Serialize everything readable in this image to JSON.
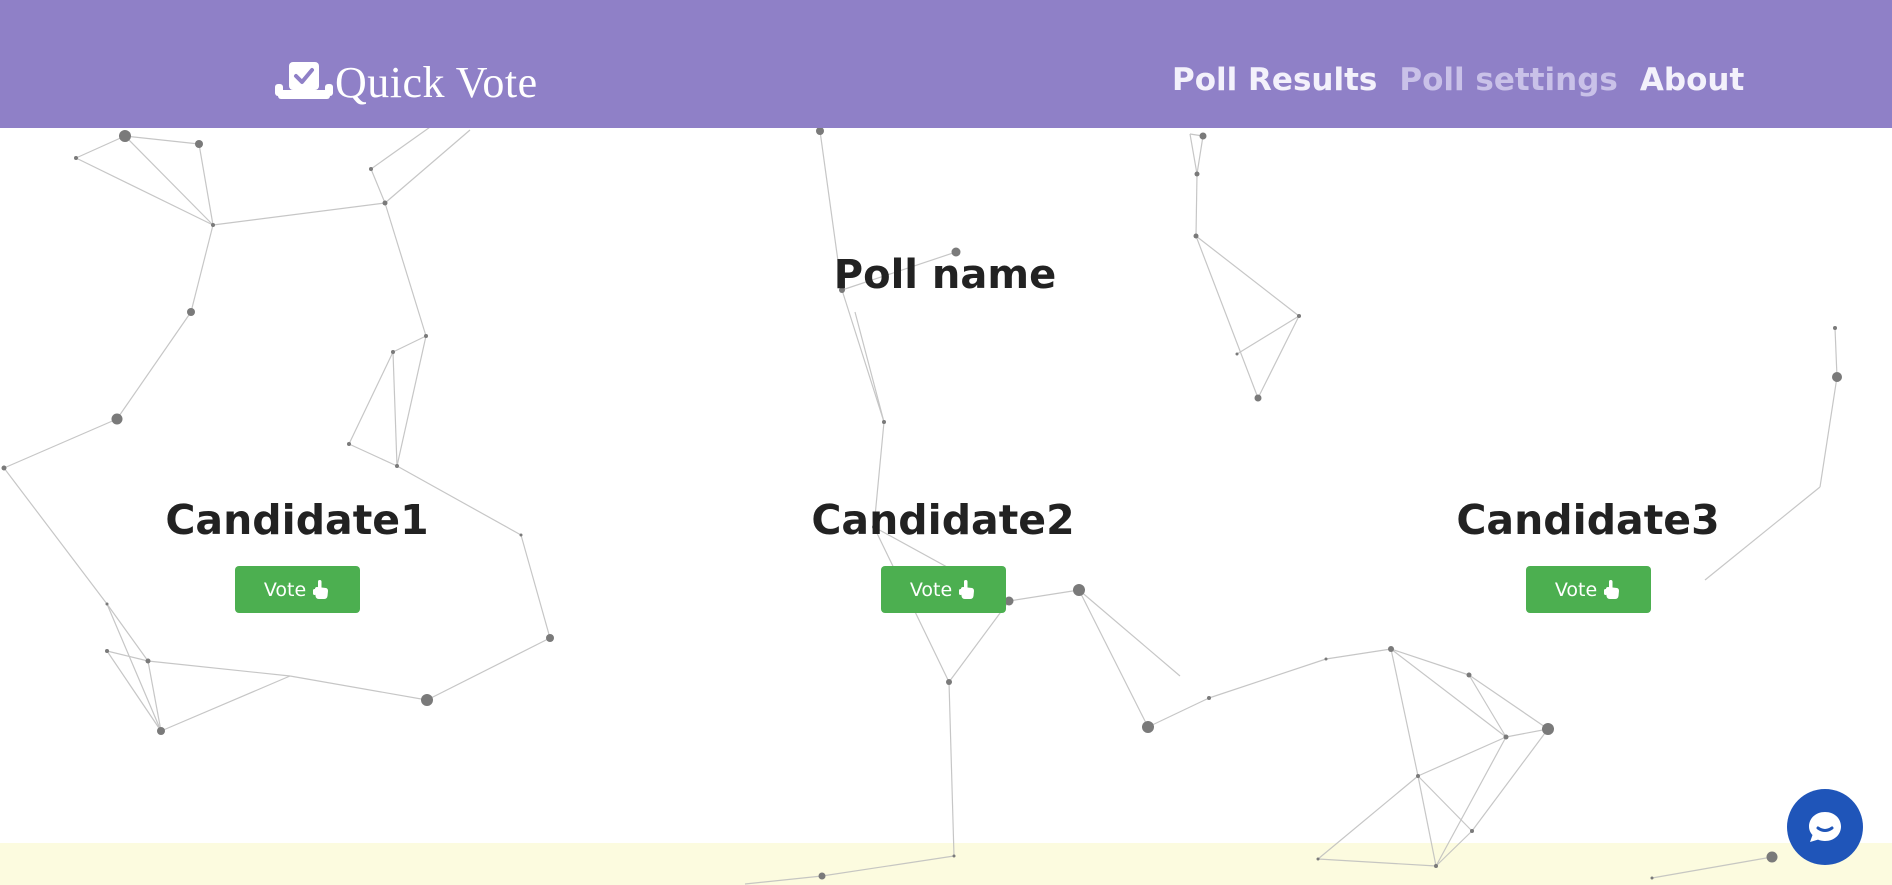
{
  "navbar": {
    "brand": "Quick Vote",
    "links": [
      {
        "label": "Poll Results",
        "state": "active"
      },
      {
        "label": "Poll settings",
        "state": "muted"
      },
      {
        "label": "About",
        "state": "active"
      }
    ],
    "background_color": "#8f80c7"
  },
  "poll": {
    "name": "Poll name",
    "candidates": [
      {
        "name": "Candidate1",
        "vote_label": "Vote"
      },
      {
        "name": "Candidate2",
        "vote_label": "Vote"
      },
      {
        "name": "Candidate3",
        "vote_label": "Vote"
      }
    ]
  },
  "colors": {
    "vote_button": "#4caf50",
    "chat_button": "#1f55b9",
    "footer": "#fcfbdf"
  },
  "icons": {
    "brand": "ballot-box-check-icon",
    "vote": "pointing-hand-icon",
    "chat": "chat-bubble-icon"
  }
}
